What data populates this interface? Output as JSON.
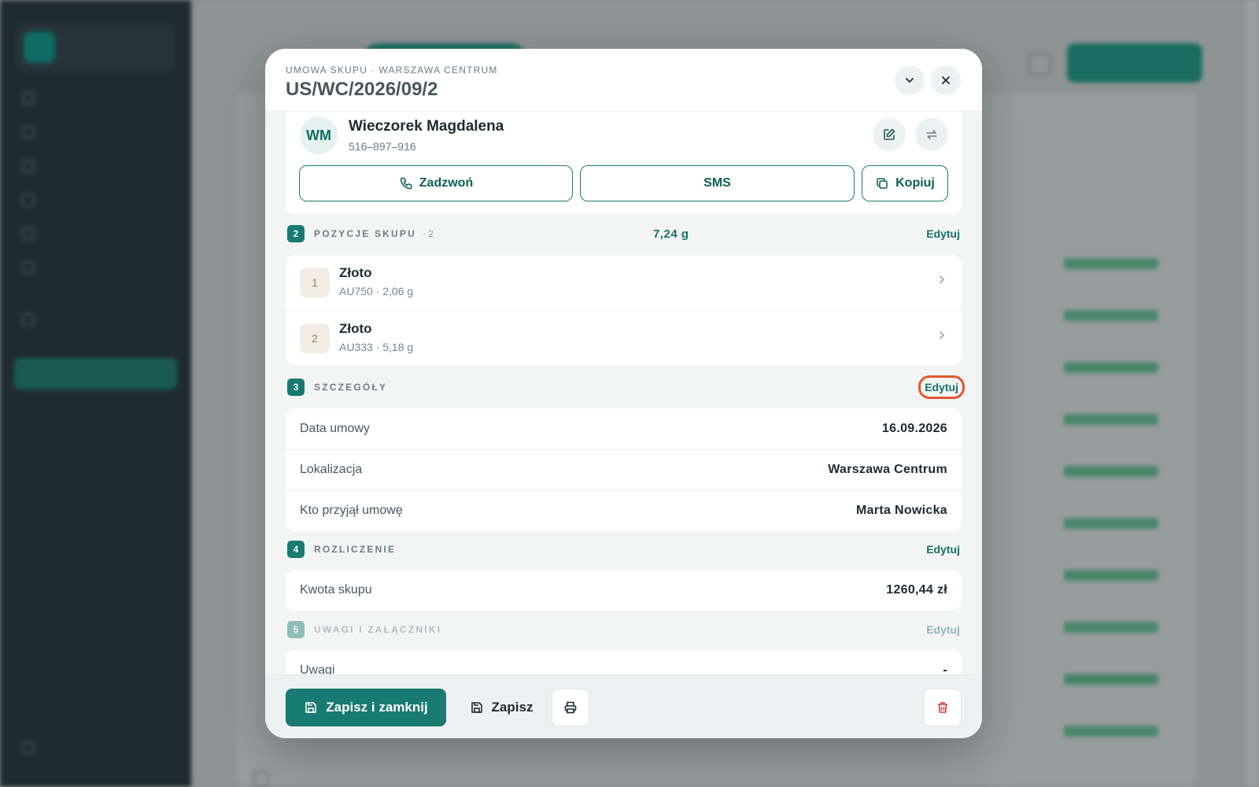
{
  "modal": {
    "kicker": "UMOWA SKUPU · WARSZAWA CENTRUM",
    "title": "US/WC/2026/09/2",
    "client": {
      "initials": "WM",
      "name": "Wieczorek Magdalena",
      "phone": "516–897–916",
      "call_label": "Zadzwoń",
      "sms_label": "SMS",
      "copy_label": "Kopiuj"
    },
    "positions": {
      "number": "2",
      "title": "POZYCJE SKUPU",
      "count": "· 2",
      "total_weight": "7,24 g",
      "edit_label": "Edytuj",
      "items": [
        {
          "index": "1",
          "name": "Złoto",
          "details": "AU750 · 2,06 g"
        },
        {
          "index": "2",
          "name": "Złoto",
          "details": "AU333 · 5,18 g"
        }
      ]
    },
    "details": {
      "number": "3",
      "title": "SZCZEGÓŁY",
      "edit_label": "Edytuj",
      "rows": [
        {
          "key": "Data umowy",
          "value": "16.09.2026"
        },
        {
          "key": "Lokalizacja",
          "value": "Warszawa Centrum"
        },
        {
          "key": "Kto przyjął umowę",
          "value": "Marta Nowicka"
        }
      ]
    },
    "settlement": {
      "number": "4",
      "title": "ROZLICZENIE",
      "edit_label": "Edytuj",
      "rows": [
        {
          "key": "Kwota skupu",
          "value": "1260,44 zł"
        }
      ]
    },
    "notes": {
      "number": "5",
      "title": "UWAGI I ZAŁĄCZNIKI",
      "edit_label": "Edytuj",
      "rows": [
        {
          "key": "Uwagi",
          "value": "-"
        }
      ]
    },
    "footer": {
      "save_close_label": "Zapisz i zamknij",
      "save_label": "Zapisz"
    }
  },
  "colors": {
    "accent": "#187a70",
    "highlight": "#e4572e",
    "danger": "#d63b3b"
  }
}
